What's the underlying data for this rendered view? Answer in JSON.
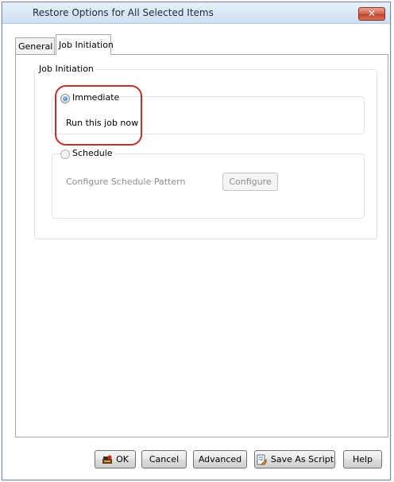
{
  "window": {
    "title": "Restore Options for All Selected Items",
    "close_glyph": "✕"
  },
  "tabs": [
    {
      "label": "General",
      "active": false
    },
    {
      "label": "Job Initiation",
      "active": true
    }
  ],
  "job_initiation": {
    "group_label": "Job Initiation",
    "immediate": {
      "label": "Immediate",
      "selected": true,
      "description": "Run this job now"
    },
    "schedule": {
      "label": "Schedule",
      "selected": false,
      "configure_label": "Configure Schedule Pattern",
      "configure_button": "Configure"
    }
  },
  "buttons": {
    "ok": "OK",
    "cancel": "Cancel",
    "advanced": "Advanced",
    "save_as_script": "Save As Script",
    "help": "Help"
  },
  "icons": {
    "close": "close-icon",
    "ok": "ok-icon",
    "script": "script-icon"
  },
  "colors": {
    "highlight": "#c0302a",
    "titlebar": "#dbe8f6",
    "close_button": "#c0432a"
  }
}
